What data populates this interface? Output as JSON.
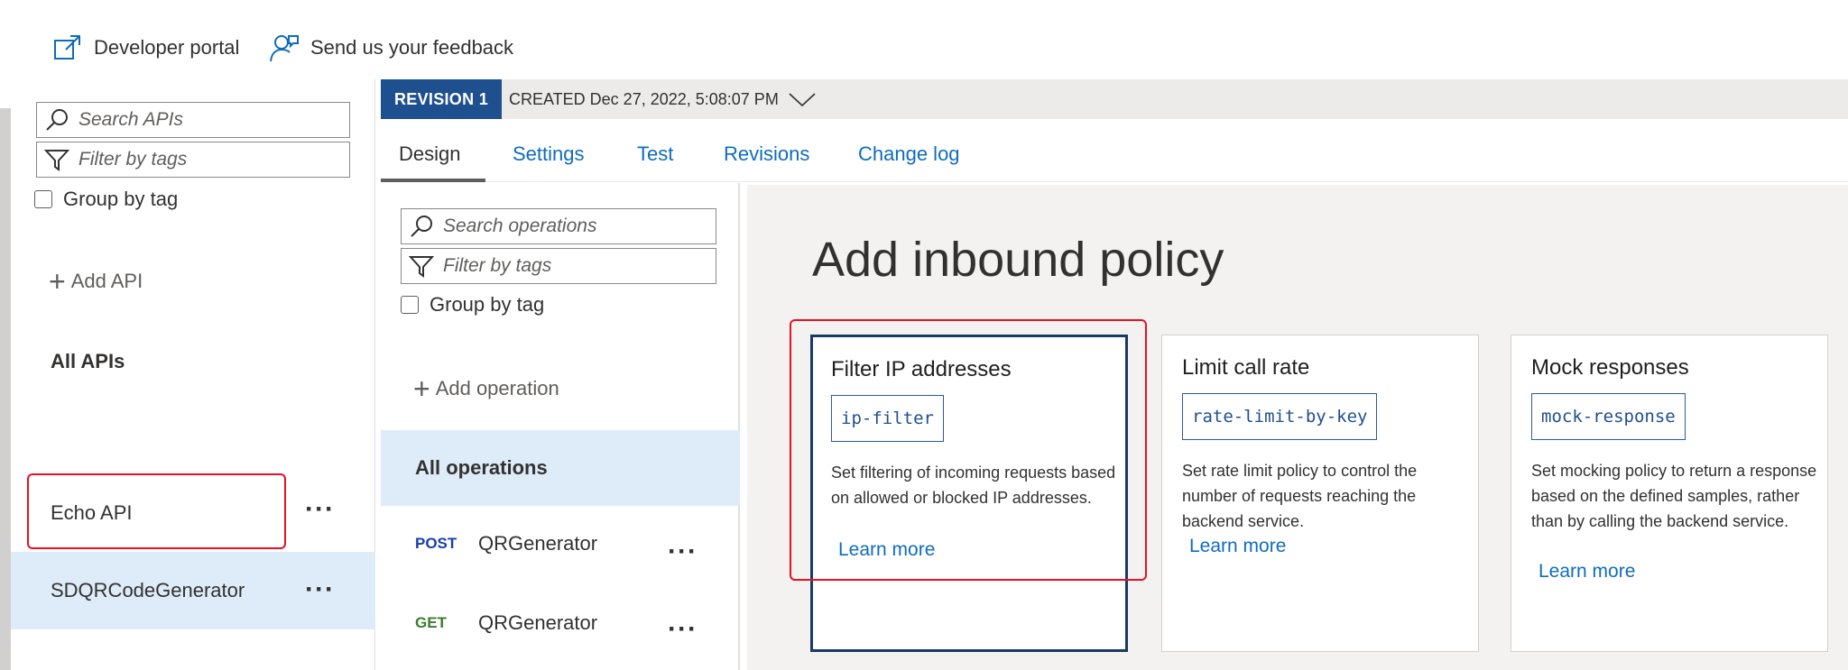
{
  "toolbar": {
    "developer_portal": "Developer portal",
    "feedback": "Send us your feedback"
  },
  "apis_panel": {
    "search_placeholder": "Search APIs",
    "filter_placeholder": "Filter by tags",
    "group_by_tag": "Group by tag",
    "add_api": "Add API",
    "all_apis": "All APIs",
    "items": [
      {
        "name": "Echo API",
        "selected": false
      },
      {
        "name": "SDQRCodeGenerator",
        "selected": true
      }
    ]
  },
  "revision": {
    "tag": "REVISION 1",
    "created": "CREATED Dec 27, 2022, 5:08:07 PM"
  },
  "tabs": [
    {
      "label": "Design",
      "active": true
    },
    {
      "label": "Settings",
      "active": false
    },
    {
      "label": "Test",
      "active": false
    },
    {
      "label": "Revisions",
      "active": false
    },
    {
      "label": "Change log",
      "active": false
    }
  ],
  "operations_panel": {
    "search_placeholder": "Search operations",
    "filter_placeholder": "Filter by tags",
    "group_by_tag": "Group by tag",
    "add_operation": "Add operation",
    "all_operations": "All operations",
    "items": [
      {
        "method": "POST",
        "name": "QRGenerator"
      },
      {
        "method": "GET",
        "name": "QRGenerator"
      }
    ]
  },
  "main": {
    "title": "Add inbound policy",
    "cards": [
      {
        "title": "Filter IP addresses",
        "code": "ip-filter",
        "description": "Set filtering of incoming requests based on allowed or blocked IP addresses.",
        "link": "Learn more",
        "selected": true
      },
      {
        "title": "Limit call rate",
        "code": "rate-limit-by-key",
        "description": "Set rate limit policy to control the number of requests reaching the backend service.",
        "link": "Learn more",
        "selected": false
      },
      {
        "title": "Mock responses",
        "code": "mock-response",
        "description": "Set mocking policy to return a response based on the defined samples, rather than by calling the backend service.",
        "link": "Learn more",
        "selected": false
      }
    ]
  },
  "colors": {
    "accent": "#0f6cbd",
    "revision_tag": "#1e4f8e",
    "selection": "#deecf9",
    "highlight": "#e81123",
    "method_post": "#1a3fa8",
    "method_get": "#3a7d2e"
  }
}
